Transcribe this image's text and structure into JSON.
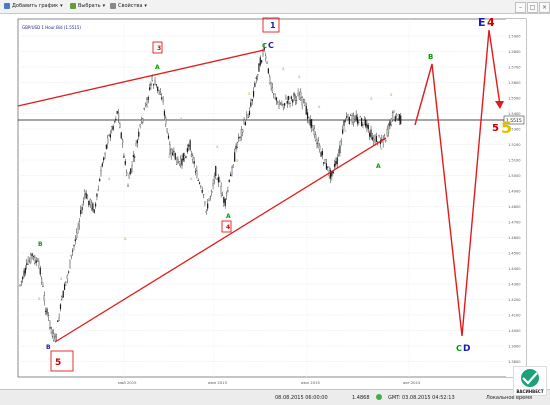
{
  "toolbar": {
    "add_chart_label": "Добавить график",
    "select_label": "Выбрать",
    "properties_label": "Свойства"
  },
  "chart_title": "GBP/USD 1 Hour Bid (1.5515)",
  "current_price_label": "1.5515",
  "status": {
    "datetime": "08.08.2015 06:00:00",
    "price": "1.4868",
    "server_time": "GMT: 03.08.2015 04:52:13",
    "local_label": "Локальное время"
  },
  "logo_text": "ВАСИНВЕСТ",
  "chart_data": {
    "type": "line",
    "x_labels": [
      "май 2015",
      "июн 2015",
      "июл 2015",
      "авг 2015"
    ],
    "y_labels": [
      "1.5900",
      "1.5800",
      "1.5700",
      "1.5600",
      "1.5500",
      "1.5400",
      "1.5300",
      "1.5200",
      "1.5100",
      "1.5000",
      "1.4900",
      "1.4800",
      "1.4700",
      "1.4600",
      "1.4500",
      "1.4400",
      "1.4300",
      "1.4200",
      "1.4100",
      "1.4000",
      "1.3900",
      "1.3800"
    ],
    "current_price": 1.5515,
    "wave_labels": [
      {
        "text": "3",
        "color": "#cc0000",
        "boxed": true
      },
      {
        "text": "5",
        "color": "#cc0000",
        "boxed": true
      },
      {
        "text": "1",
        "color": "#1a1ab0",
        "boxed": true
      },
      {
        "text": "4",
        "color": "#cc0000",
        "boxed": true
      },
      {
        "text": "E",
        "color": "#1a1ab0"
      },
      {
        "text": "4",
        "color": "#cc0000"
      },
      {
        "text": "5",
        "color": "#cc0000"
      },
      {
        "text": "5",
        "color": "#e0c000"
      },
      {
        "text": "C",
        "color": "#00a000"
      },
      {
        "text": "C",
        "color": "#1a1ab0"
      },
      {
        "text": "C",
        "color": "#00a000"
      },
      {
        "text": "D",
        "color": "#1a1ab0"
      },
      {
        "text": "B",
        "color": "#1a1ab0"
      },
      {
        "text": "A",
        "color": "#00a000"
      },
      {
        "text": "B",
        "color": "#00a000"
      },
      {
        "text": "A",
        "color": "#00a000"
      },
      {
        "text": "B",
        "color": "#00a000"
      },
      {
        "text": "A",
        "color": "#00a000"
      }
    ]
  }
}
